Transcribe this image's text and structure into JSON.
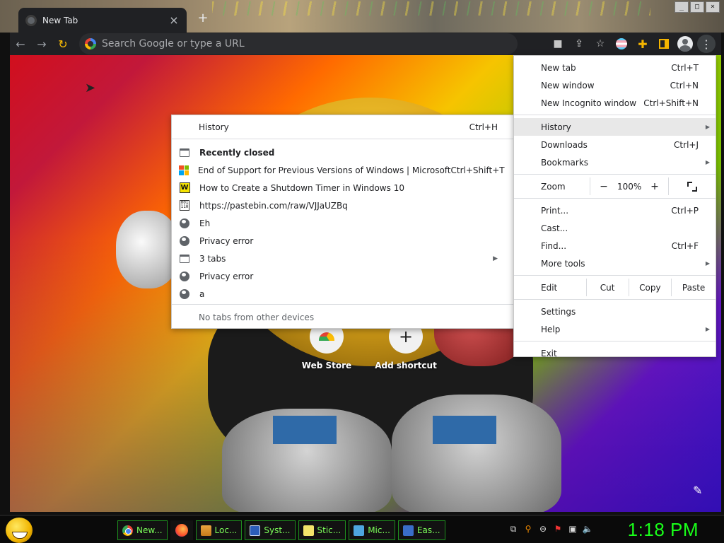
{
  "browser": {
    "tab_title": "New Tab",
    "tab_close": "×",
    "new_tab_symbol": "+",
    "window_buttons": [
      "_",
      "□",
      "×"
    ],
    "omnibox_placeholder": "Search Google or type a URL"
  },
  "toolbar_icons": [
    "back-icon",
    "forward-icon",
    "reload-icon",
    "camera-icon",
    "share-icon",
    "bookmark-star-icon",
    "extension-icon",
    "puzzle-icon",
    "side-panel-icon",
    "avatar-icon",
    "kebab-menu-icon"
  ],
  "new_tab_page": {
    "shortcuts": [
      {
        "label": "Web Store"
      },
      {
        "label": "Add shortcut",
        "symbol": "+"
      }
    ]
  },
  "history_submenu": {
    "header": {
      "label": "History",
      "shortcut": "Ctrl+H"
    },
    "items": [
      {
        "icon": "window-icon",
        "label": "Recently closed",
        "bold": true
      },
      {
        "icon": "microsoft-icon",
        "label": "End of Support for Previous Versions of Windows | Microsoft",
        "shortcut": "Ctrl+Shift+T"
      },
      {
        "icon": "w-favicon-icon",
        "label": "How to Create a Shutdown Timer in Windows 10"
      },
      {
        "icon": "binary-file-icon",
        "label": "https://pastebin.com/raw/VJJaUZBq"
      },
      {
        "icon": "globe-icon",
        "label": "Eh"
      },
      {
        "icon": "globe-icon",
        "label": "Privacy error"
      },
      {
        "icon": "window-icon",
        "label": "3 tabs",
        "has_submenu": true
      },
      {
        "icon": "globe-icon",
        "label": "Privacy error"
      },
      {
        "icon": "globe-icon",
        "label": "a"
      }
    ],
    "footer": "No tabs from other devices"
  },
  "main_menu": {
    "new_tab": {
      "label": "New tab",
      "shortcut": "Ctrl+T"
    },
    "new_window": {
      "label": "New window",
      "shortcut": "Ctrl+N"
    },
    "incognito": {
      "label": "New Incognito window",
      "shortcut": "Ctrl+Shift+N"
    },
    "history": {
      "label": "History"
    },
    "downloads": {
      "label": "Downloads",
      "shortcut": "Ctrl+J"
    },
    "bookmarks": {
      "label": "Bookmarks"
    },
    "zoom": {
      "label": "Zoom",
      "minus": "−",
      "value": "100%",
      "plus": "+"
    },
    "print": {
      "label": "Print...",
      "shortcut": "Ctrl+P"
    },
    "cast": {
      "label": "Cast..."
    },
    "find": {
      "label": "Find...",
      "shortcut": "Ctrl+F"
    },
    "more_tools": {
      "label": "More tools"
    },
    "edit": {
      "label": "Edit",
      "cut": "Cut",
      "copy": "Copy",
      "paste": "Paste"
    },
    "settings": {
      "label": "Settings"
    },
    "help": {
      "label": "Help"
    },
    "exit": {
      "label": "Exit"
    }
  },
  "taskbar": {
    "tasks": [
      {
        "icon": "chrome-icon",
        "label": "New..."
      },
      {
        "icon": "firefox-icon",
        "label": ""
      },
      {
        "icon": "folder-icon",
        "label": "Loc..."
      },
      {
        "icon": "system-icon",
        "label": "Syst..."
      },
      {
        "icon": "sticky-notes-icon",
        "label": "Stic..."
      },
      {
        "icon": "microphone-icon",
        "label": "Mic..."
      },
      {
        "icon": "ease-of-access-icon",
        "label": "Eas..."
      }
    ],
    "tray_icons": [
      "network-icon",
      "search-icon",
      "minus-circle-icon",
      "flag-icon",
      "display-icon",
      "volume-icon"
    ],
    "clock": "1:18 PM"
  },
  "colors": {
    "clock": "#19ff19",
    "task_text": "#7dff5a",
    "menu_bg": "#ffffff",
    "toolbar_bg": "#202124"
  }
}
